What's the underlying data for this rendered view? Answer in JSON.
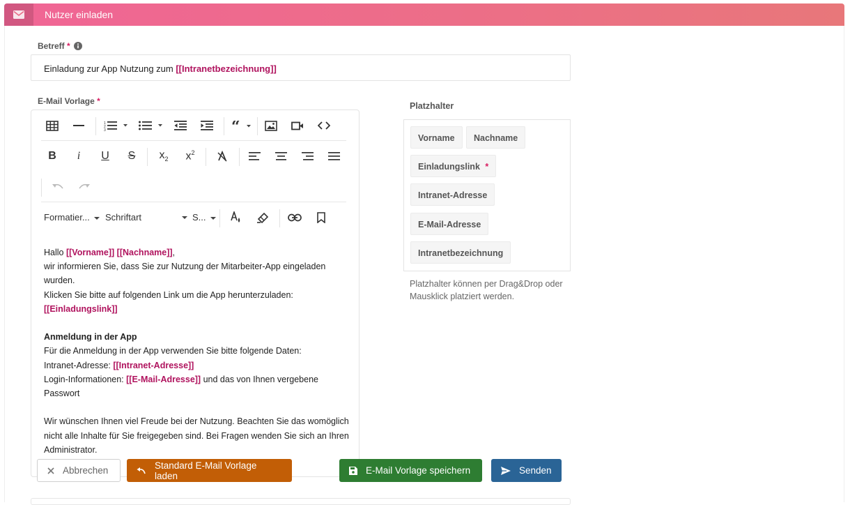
{
  "header": {
    "title": "Nutzer einladen",
    "icon": "envelope-icon"
  },
  "subject": {
    "label": "Betreff",
    "required_mark": "*",
    "value_prefix": "Einladung zur App Nutzung zum ",
    "value_token": "[[Intranetbezeichnung]]"
  },
  "editor": {
    "label": "E-Mail Vorlage",
    "required_mark": "*",
    "toolbar": {
      "format_label": "Formatier...",
      "font_label": "Schriftart",
      "size_label": "S..."
    },
    "content": {
      "greeting": "Hallo ",
      "tok_vorname": "[[Vorname]]",
      "space": " ",
      "tok_nachname": "[[Nachname]]",
      "comma": ",",
      "line2": "wir informieren Sie, dass Sie zur Nutzung der Mitarbeiter-App eingeladen wurden.",
      "line3": "Klicken Sie bitte auf folgenden Link um die App herunterzuladen:",
      "tok_einladungslink": "[[Einladungslink]]",
      "heading": "Anmeldung in der App",
      "line5": "Für die Anmeldung in der App verwenden Sie bitte folgende Daten:",
      "intranet_label": "Intranet-Adresse: ",
      "tok_intranet": "[[Intranet-Adresse]]",
      "login_label": "Login-Informationen: ",
      "tok_email": "[[E-Mail-Adresse]]",
      "login_suffix": " und das von Ihnen vergebene Passwort",
      "closing": "Wir wünschen Ihnen viel Freude bei der Nutzung. Beachten Sie das womöglich nicht alle Inhalte für Sie freigegeben sind. Bei Fragen wenden Sie sich an Ihren Administrator."
    }
  },
  "placeholders": {
    "title": "Platzhalter",
    "chips": {
      "vorname": "Vorname",
      "nachname": "Nachname",
      "einladungslink": "Einladungslink",
      "einladungslink_required": "*",
      "intranet_adresse": "Intranet-Adresse",
      "email_adresse": "E-Mail-Adresse",
      "intranetbezeichnung": "Intranetbezeichnung"
    },
    "hint": "Platzhalter können per Drag&Drop oder Mausklick platziert werden."
  },
  "actions": {
    "cancel": "Abbrechen",
    "load_default": "Standard E-Mail Vorlage laden",
    "save_template": "E-Mail Vorlage speichern",
    "send": "Senden"
  },
  "colors": {
    "header_start": "#f06595",
    "header_end": "#e8777a",
    "placeholder_token": "#b0135e",
    "btn_load_default": "#c25e06",
    "btn_save": "#2e7d32",
    "btn_send": "#2a6496"
  }
}
